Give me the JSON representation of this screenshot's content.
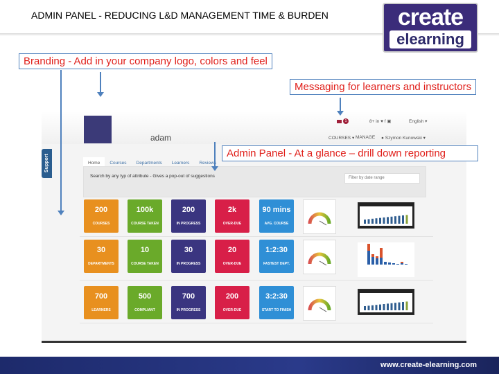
{
  "slide": {
    "title": "ADMIN PANEL - REDUCING L&D MANAGEMENT TIME & BURDEN",
    "logo_top": "create",
    "logo_bottom": "elearning",
    "footer_url": "www.create-elearning.com"
  },
  "callouts": {
    "branding": "Branding - Add in your company logo, colors and feel",
    "messaging": "Messaging for learners and instructors",
    "admin": "Admin Panel - At a glance – drill down reporting"
  },
  "app": {
    "support": "Support",
    "site_name": "adam",
    "message_count": "1",
    "social": "8+ in ♥ f ▣",
    "language": "English ▾",
    "nav": [
      "COURSES ▾",
      "MANAGE",
      "Szymon Kunowski ▾"
    ],
    "tabs": [
      "Home",
      "Courses",
      "Departments",
      "Learners",
      "Reviews"
    ],
    "search_hint": "Search by any typ of attribute - Gives a pop-out of suggestions",
    "filter_placeholder": "Filter by date range",
    "rows": [
      [
        {
          "v": "200",
          "l": "COURSES"
        },
        {
          "v": "100k",
          "l": "COURSE TAKEN"
        },
        {
          "v": "200",
          "l": "IN PROGRESS"
        },
        {
          "v": "2k",
          "l": "OVER-DUE"
        },
        {
          "v": "90 mins",
          "l": "AVG. COURSE"
        }
      ],
      [
        {
          "v": "30",
          "l": "DEPARTMENTS"
        },
        {
          "v": "10",
          "l": "COURSE TAKEN"
        },
        {
          "v": "30",
          "l": "IN PROGRESS"
        },
        {
          "v": "20",
          "l": "OVER-DUE"
        },
        {
          "v": "1:2:30",
          "l": "FASTEST DEPT."
        }
      ],
      [
        {
          "v": "700",
          "l": "LEARNERS"
        },
        {
          "v": "500",
          "l": "COMPLIANT"
        },
        {
          "v": "700",
          "l": "IN PROGRESS"
        },
        {
          "v": "200",
          "l": "OVER-DUE"
        },
        {
          "v": "3:2:30",
          "l": "START TO FINISH"
        }
      ]
    ]
  },
  "colors": {
    "orange": "#e8901f",
    "green": "#6aaa2a",
    "purple": "#3a3580",
    "red": "#d81f48",
    "blue": "#2f8fd6",
    "callout_text": "#e0201b",
    "callout_border": "#4f81bd"
  }
}
